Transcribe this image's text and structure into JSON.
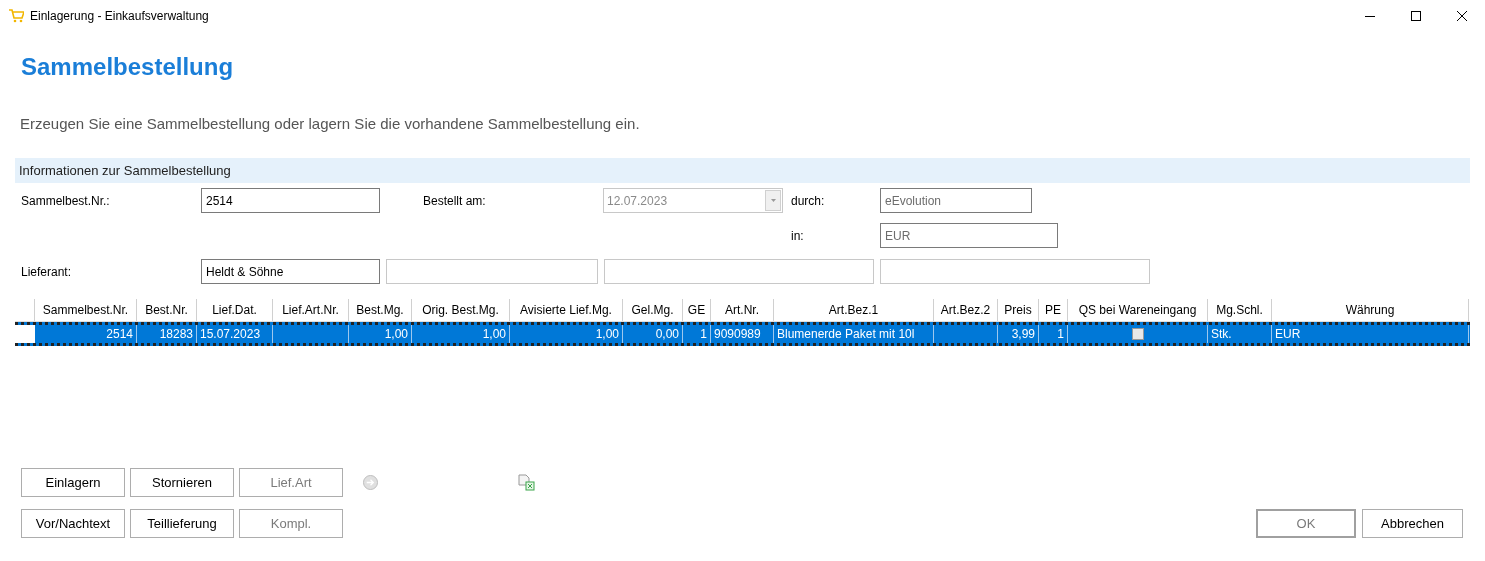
{
  "window": {
    "title": "Einlagerung - Einkaufsverwaltung"
  },
  "heading": "Sammelbestellung",
  "description": "Erzeugen Sie eine Sammelbestellung oder lagern Sie die vorhandene Sammelbestellung ein.",
  "section": {
    "title": "Informationen zur Sammelbestellung"
  },
  "fields": {
    "order_no": {
      "label": "Sammelbest.Nr.:",
      "value": "2514",
      "disabled": false
    },
    "ordered_on": {
      "label": "Bestellt am:",
      "value": "12.07.2023",
      "disabled": true
    },
    "by": {
      "label": "durch:",
      "value": "eEvolution",
      "disabled": true
    },
    "currency": {
      "label": "in:",
      "value": "EUR",
      "disabled": true
    },
    "supplier": {
      "label": "Lieferant:",
      "value": "Heldt & Söhne",
      "disabled": false
    }
  },
  "table": {
    "columns": [
      {
        "label": "Sammelbest.Nr.",
        "kind": "number"
      },
      {
        "label": "Best.Nr.",
        "kind": "number"
      },
      {
        "label": "Lief.Dat.",
        "kind": "text"
      },
      {
        "label": "Lief.Art.Nr.",
        "kind": "text"
      },
      {
        "label": "Best.Mg.",
        "kind": "number"
      },
      {
        "label": "Orig. Best.Mg.",
        "kind": "number"
      },
      {
        "label": "Avisierte Lief.Mg.",
        "kind": "number"
      },
      {
        "label": "Gel.Mg.",
        "kind": "number"
      },
      {
        "label": "GE",
        "kind": "number"
      },
      {
        "label": "Art.Nr.",
        "kind": "text"
      },
      {
        "label": "Art.Bez.1",
        "kind": "text"
      },
      {
        "label": "Art.Bez.2",
        "kind": "text"
      },
      {
        "label": "Preis",
        "kind": "number"
      },
      {
        "label": "PE",
        "kind": "number"
      },
      {
        "label": "QS bei Wareneingang",
        "kind": "check"
      },
      {
        "label": "Mg.Schl.",
        "kind": "text"
      },
      {
        "label": "Währung",
        "kind": "text"
      }
    ],
    "rows": [
      {
        "selected": true,
        "cells": [
          "2514",
          "18283",
          "15.07.2023",
          "",
          "1,00",
          "1,00",
          "1,00",
          "0,00",
          "1",
          "9090989",
          "Blumenerde Paket mit 10l",
          "",
          "3,99",
          "1",
          {
            "checked": false
          },
          "Stk.",
          "EUR"
        ]
      }
    ]
  },
  "buttons_left": [
    {
      "label": "Einlagern",
      "disabled": false
    },
    {
      "label": "Stornieren",
      "disabled": false
    },
    {
      "label": "Lief.Art",
      "disabled": true
    },
    {
      "label": "Vor/Nachtext",
      "disabled": false
    },
    {
      "label": "Teillieferung",
      "disabled": false
    },
    {
      "label": "Kompl.",
      "disabled": true
    }
  ],
  "buttons_right": [
    {
      "label": "OK",
      "disabled": true,
      "default": true
    },
    {
      "label": "Abbrechen",
      "disabled": false,
      "default": false
    }
  ]
}
